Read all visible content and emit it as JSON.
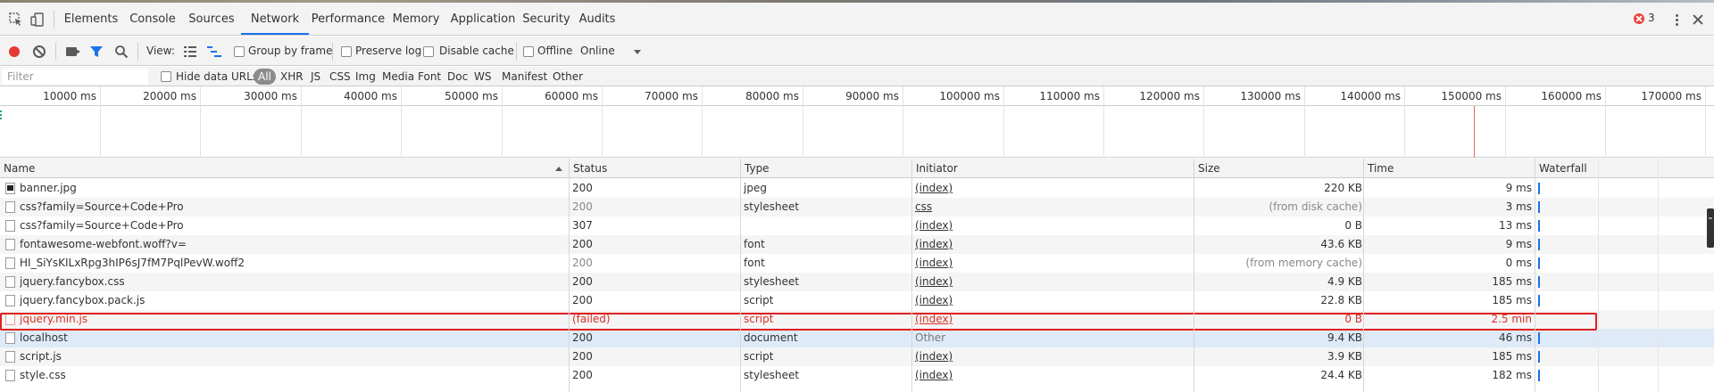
{
  "panel_tabs": [
    "Elements",
    "Console",
    "Sources",
    "Network",
    "Performance",
    "Memory",
    "Application",
    "Security",
    "Audits"
  ],
  "active_tab": "Network",
  "error_count": "3",
  "toolbar": {
    "view_label": "View:",
    "group_by_frame": "Group by frame",
    "preserve_log": "Preserve log",
    "disable_cache": "Disable cache",
    "offline": "Offline",
    "throttle": "Online"
  },
  "filter": {
    "placeholder": "Filter",
    "hide_data_urls": "Hide data URLs",
    "types": [
      "All",
      "XHR",
      "JS",
      "CSS",
      "Img",
      "Media",
      "Font",
      "Doc",
      "WS",
      "Manifest",
      "Other"
    ]
  },
  "timeline_ticks": [
    "10000 ms",
    "20000 ms",
    "30000 ms",
    "40000 ms",
    "50000 ms",
    "60000 ms",
    "70000 ms",
    "80000 ms",
    "90000 ms",
    "100000 ms",
    "110000 ms",
    "120000 ms",
    "130000 ms",
    "140000 ms",
    "150000 ms",
    "160000 ms",
    "170000 ms"
  ],
  "columns": [
    "Name",
    "Status",
    "Type",
    "Initiator",
    "Size",
    "Time",
    "Waterfall"
  ],
  "requests": [
    {
      "name": "banner.jpg",
      "status": "200",
      "type": "jpeg",
      "initiator": "(index)",
      "size": "220 KB",
      "time": "9 ms",
      "icon": "image-file-icon"
    },
    {
      "name": "css?family=Source+Code+Pro",
      "status": "200",
      "type": "stylesheet",
      "initiator": "css",
      "size": "(from disk cache)",
      "time": "3 ms",
      "icon": "file-icon"
    },
    {
      "name": "css?family=Source+Code+Pro",
      "status": "307",
      "type": "",
      "initiator": "(index)",
      "size": "0 B",
      "time": "13 ms",
      "icon": "file-icon"
    },
    {
      "name": "fontawesome-webfont.woff?v=",
      "status": "200",
      "type": "font",
      "initiator": "(index)",
      "size": "43.6 KB",
      "time": "9 ms",
      "icon": "file-icon"
    },
    {
      "name": "HI_SiYsKILxRpg3hIP6sJ7fM7PqlPevW.woff2",
      "status": "200",
      "type": "font",
      "initiator": "(index)",
      "size": "(from memory cache)",
      "time": "0 ms",
      "icon": "file-icon"
    },
    {
      "name": "jquery.fancybox.css",
      "status": "200",
      "type": "stylesheet",
      "initiator": "(index)",
      "size": "4.9 KB",
      "time": "185 ms",
      "icon": "file-icon"
    },
    {
      "name": "jquery.fancybox.pack.js",
      "status": "200",
      "type": "script",
      "initiator": "(index)",
      "size": "22.8 KB",
      "time": "185 ms",
      "icon": "file-icon"
    },
    {
      "name": "jquery.min.js",
      "status": "(failed)",
      "type": "script",
      "initiator": "(index)",
      "size": "0 B",
      "time": "2.5 min",
      "icon": "file-icon",
      "failed": true
    },
    {
      "name": "localhost",
      "status": "200",
      "type": "document",
      "initiator": "Other",
      "size": "9.4 KB",
      "time": "46 ms",
      "icon": "file-icon",
      "selected": true
    },
    {
      "name": "script.js",
      "status": "200",
      "type": "script",
      "initiator": "(index)",
      "size": "3.9 KB",
      "time": "185 ms",
      "icon": "file-icon"
    },
    {
      "name": "style.css",
      "status": "200",
      "type": "stylesheet",
      "initiator": "(index)",
      "size": "24.4 KB",
      "time": "182 ms",
      "icon": "file-icon"
    }
  ],
  "colors": {
    "accent": "#1a73e8",
    "error": "#d93025",
    "record": "#e53935"
  }
}
